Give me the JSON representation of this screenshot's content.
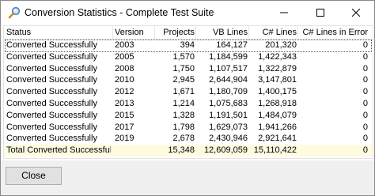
{
  "window": {
    "title": "Conversion Statistics - Complete Test Suite",
    "icon": "magnifier-icon"
  },
  "columns": [
    "Status",
    "Version",
    "Projects",
    "VB Lines",
    "C# Lines",
    "C# Lines in Error"
  ],
  "rows": [
    [
      "Converted Successfully",
      "2003",
      "394",
      "164,127",
      "201,320",
      "0"
    ],
    [
      "Converted Successfully",
      "2005",
      "1,570",
      "1,184,599",
      "1,422,343",
      "0"
    ],
    [
      "Converted Successfully",
      "2008",
      "1,750",
      "1,107,517",
      "1,322,879",
      "0"
    ],
    [
      "Converted Successfully",
      "2010",
      "2,945",
      "2,644,904",
      "3,147,801",
      "0"
    ],
    [
      "Converted Successfully",
      "2012",
      "1,671",
      "1,180,709",
      "1,400,175",
      "0"
    ],
    [
      "Converted Successfully",
      "2013",
      "1,214",
      "1,075,683",
      "1,268,918",
      "0"
    ],
    [
      "Converted Successfully",
      "2015",
      "1,328",
      "1,191,501",
      "1,484,079",
      "0"
    ],
    [
      "Converted Successfully",
      "2017",
      "1,798",
      "1,629,073",
      "1,941,266",
      "0"
    ],
    [
      "Converted Successfully",
      "2019",
      "2,678",
      "2,430,946",
      "2,921,641",
      "0"
    ]
  ],
  "total": [
    "Total Converted Successfully",
    "",
    "15,348",
    "12,609,059",
    "15,110,422",
    "0"
  ],
  "footer": {
    "close_label": "Close"
  },
  "colors": {
    "total_row_bg": "#fffbe0",
    "footer_bg": "#f0f0f0"
  }
}
